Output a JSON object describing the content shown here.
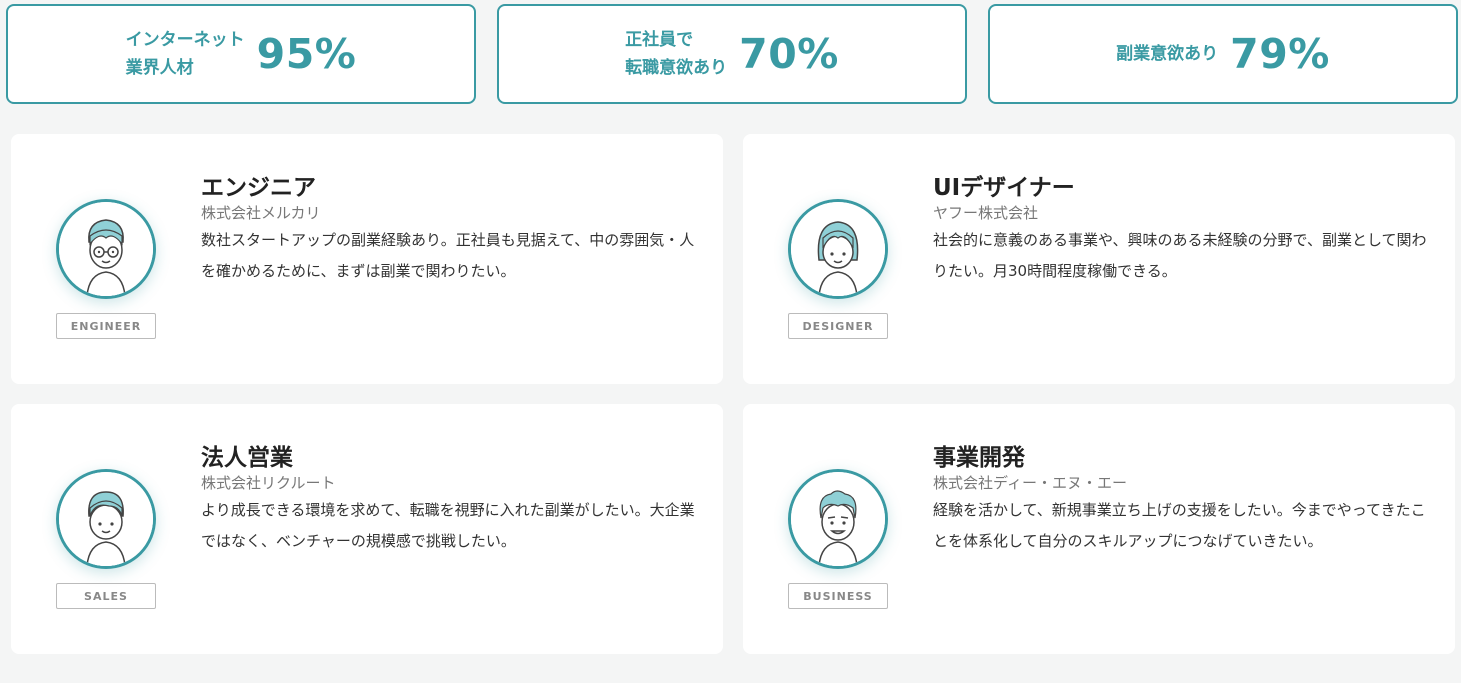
{
  "stats": [
    {
      "label": "インターネット\n業界人材",
      "value": "95%"
    },
    {
      "label": "正社員で\n転職意欲あり",
      "value": "70%"
    },
    {
      "label": "副業意欲あり",
      "value": "79%"
    }
  ],
  "cards": [
    {
      "title": "エンジニア",
      "company": "株式会社メルカリ",
      "description": "数社スタートアップの副業経験あり。正社員も見据えて、中の雰囲気・人を確かめるために、まずは副業で関わりたい。",
      "role": "ENGINEER"
    },
    {
      "title": "UIデザイナー",
      "company": "ヤフー株式会社",
      "description": "社会的に意義のある事業や、興味のある未経験の分野で、副業として関わりたい。月30時間程度稼働できる。",
      "role": "DESIGNER"
    },
    {
      "title": "法人営業",
      "company": "株式会社リクルート",
      "description": "より成長できる環境を求めて、転職を視野に入れた副業がしたい。大企業ではなく、ベンチャーの規模感で挑戦したい。",
      "role": "SALES"
    },
    {
      "title": "事業開発",
      "company": "株式会社ディー・エヌ・エー",
      "description": "経験を活かして、新規事業立ち上げの支援をしたい。今までやってきたことを体系化して自分のスキルアップにつなげていきたい。",
      "role": "BUSINESS"
    }
  ],
  "colors": {
    "accent": "#3a9aa3",
    "hair": "#8fd0d6"
  },
  "icons": [
    "engineer-avatar-icon",
    "designer-avatar-icon",
    "sales-avatar-icon",
    "business-avatar-icon"
  ]
}
